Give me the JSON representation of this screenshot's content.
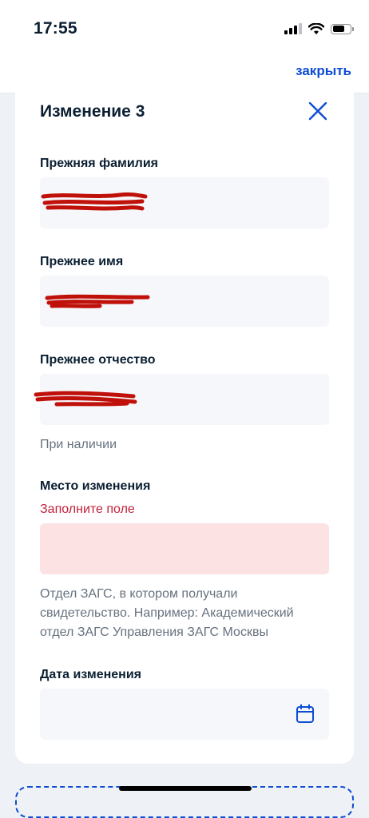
{
  "status_bar": {
    "time": "17:55"
  },
  "header": {
    "close_label": "закрыть"
  },
  "card": {
    "title": "Изменение 3",
    "fields": {
      "prev_surname": {
        "label": "Прежняя фамилия",
        "value": ""
      },
      "prev_name": {
        "label": "Прежнее имя",
        "value": ""
      },
      "prev_patronymic": {
        "label": "Прежнее отчество",
        "value": "",
        "hint": "При наличии"
      },
      "change_place": {
        "label": "Место изменения",
        "error": "Заполните поле",
        "value": "",
        "hint": "Отдел ЗАГС, в котором получали свидетельство. Например: Академический отдел ЗАГС Управления ЗАГС Москвы"
      },
      "change_date": {
        "label": "Дата изменения",
        "value": ""
      }
    }
  },
  "colors": {
    "accent": "#0d4cd3",
    "error": "#c3213b",
    "error_bg": "#fde2e4",
    "field_bg": "#f5f7fa",
    "redaction": "#c0100a"
  }
}
